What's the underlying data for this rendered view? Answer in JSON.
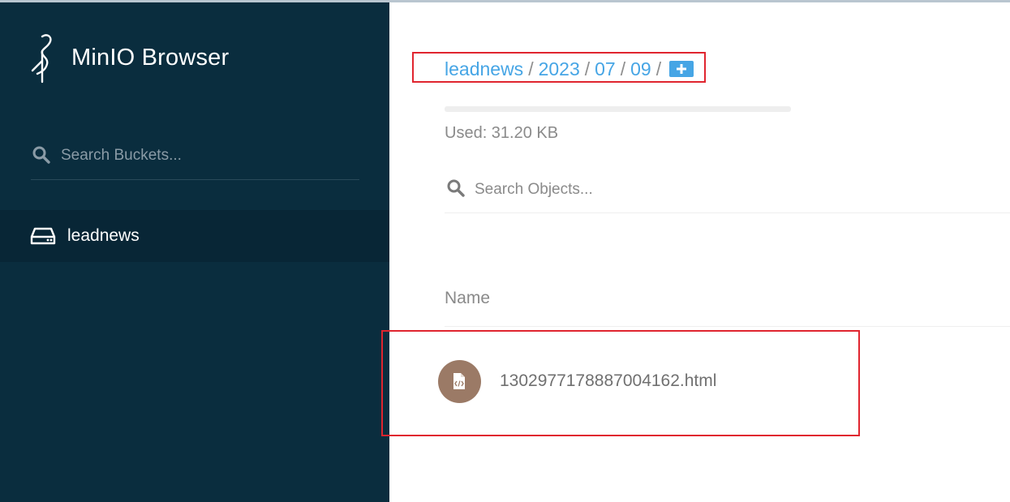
{
  "app": {
    "title": "MinIO Browser"
  },
  "sidebar": {
    "search": {
      "placeholder": "Search Buckets..."
    },
    "buckets": [
      {
        "label": "leadnews"
      }
    ]
  },
  "breadcrumb": {
    "parts": [
      "leadnews",
      "2023",
      "07",
      "09"
    ],
    "separator": "/"
  },
  "storage": {
    "used": "Used: 31.20 KB"
  },
  "objects": {
    "search": {
      "placeholder": "Search Objects..."
    },
    "column_name": "Name",
    "items": [
      {
        "name": "1302977178887004162.html"
      }
    ]
  },
  "colors": {
    "sidebar_bg": "#0a2d3e",
    "accent": "#46a5e5",
    "highlight": "#e0252f",
    "file_icon_bg": "#9b7a66"
  },
  "icons": {
    "logo": "minio-heron-icon",
    "bucket_search": "search-icon",
    "bucket": "drive-icon",
    "add": "plus-icon",
    "object_search": "search-icon",
    "file": "html-file-icon"
  }
}
